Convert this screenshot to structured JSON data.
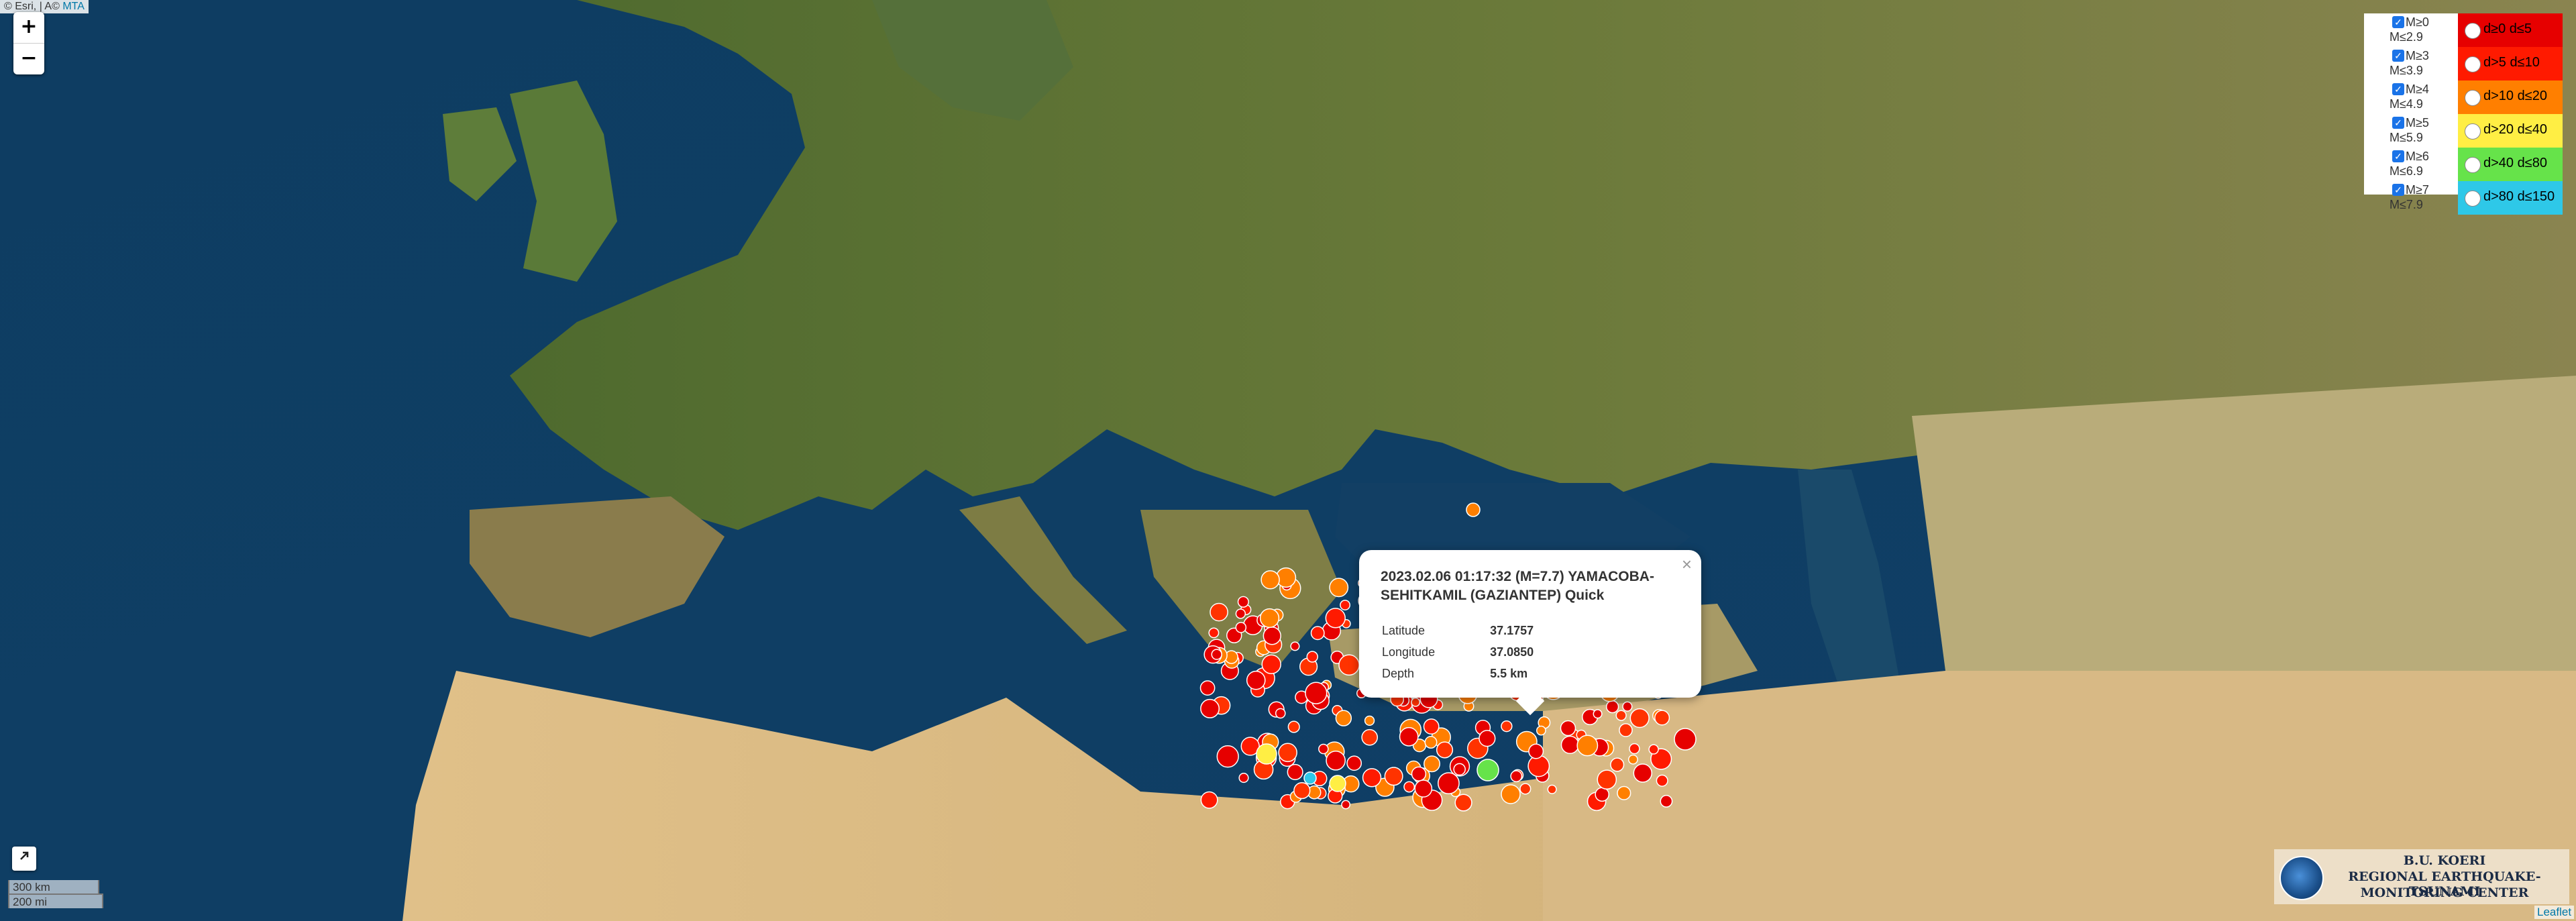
{
  "attribution": {
    "esri": "© Esri,",
    "sep": "|",
    "acm": "A©",
    "mta": "MTA"
  },
  "zoom": {
    "in_label": "+",
    "out_label": "−"
  },
  "scale": {
    "metric": "300 km",
    "imperial": "200 mi"
  },
  "magnitude_legend": [
    {
      "top": "M≥0",
      "bottom": "M≤2.9",
      "checked": true
    },
    {
      "top": "M≥3",
      "bottom": "M≤3.9",
      "checked": true
    },
    {
      "top": "M≥4",
      "bottom": "M≤4.9",
      "checked": true
    },
    {
      "top": "M≥5",
      "bottom": "M≤5.9",
      "checked": true
    },
    {
      "top": "M≥6",
      "bottom": "M≤6.9",
      "checked": true
    },
    {
      "top": "M≥7",
      "bottom": "M≤7.9",
      "checked": true
    }
  ],
  "depth_legend": [
    {
      "label": "d≥0   d≤5",
      "color": "#e60000"
    },
    {
      "label": "d>5   d≤10",
      "color": "#ff1a00"
    },
    {
      "label": "d>10  d≤20",
      "color": "#ff7f00"
    },
    {
      "label": "d>20  d≤40",
      "color": "#ffee44"
    },
    {
      "label": "d>40  d≤80",
      "color": "#66e34a"
    },
    {
      "label": "d>80 d≤150",
      "color": "#2ec8e8"
    }
  ],
  "popup": {
    "title": "2023.02.06 01:17:32 (M=7.7) YAMACOBA-SEHITKAMIL (GAZIANTEP) Quick",
    "close": "×",
    "rows": [
      {
        "label": "Latitude",
        "value": "37.1757"
      },
      {
        "label": "Longitude",
        "value": "37.0850"
      },
      {
        "label": "Depth",
        "value": "5.5 km"
      }
    ]
  },
  "logo": {
    "line1": "B.U. KOERI",
    "line2": "REGIONAL EARTHQUAKE-TSUNAMI",
    "line3": "MONITORING CENTER"
  },
  "fullscreen_icon": "expand-arrow-icon",
  "leaflet_label": "Leaflet"
}
